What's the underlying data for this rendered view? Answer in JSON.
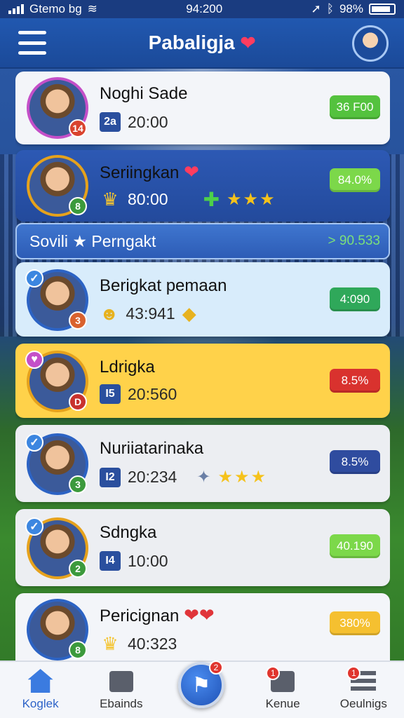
{
  "status_bar": {
    "carrier": "Gtemo bg",
    "time": "94:200",
    "battery": "98%"
  },
  "header": {
    "title": "Pabaligja",
    "menu_icon": "hamburger-icon",
    "heart_icon": "heart-icon",
    "avatar_icon": "profile-avatar"
  },
  "rows_top": [
    {
      "name": "Noghi Sade",
      "level": "14",
      "rank_icon": "rank-chip",
      "rank_text": "2a",
      "score": "20:00",
      "badge": "36 F00",
      "badge_color": "#54c23e"
    },
    {
      "name": "Seriingkan",
      "level": "8",
      "rank_icon": "crown-icon",
      "score": "80:00",
      "badge": "84.0%",
      "badge_color": "#7cd84a",
      "stars": "★★★"
    }
  ],
  "section": {
    "title": "Sovili ★ Perngakt",
    "value": "> 90.533"
  },
  "rows": [
    {
      "name": "Berigkat pemaan",
      "level": "3",
      "score": "43:941",
      "badge": "4:090",
      "badge_color": "#2fa85a"
    },
    {
      "name": "Ldrigka",
      "level": "D",
      "rank_text": "I5",
      "score": "20:560",
      "badge": "8.5%",
      "badge_color": "#d9322e"
    },
    {
      "name": "Nuriiatarinaka",
      "level": "3",
      "rank_text": "I2",
      "score": "20:234",
      "badge": "8.5%",
      "badge_color": "#2f4c9f",
      "stars": "★★★"
    },
    {
      "name": "Sdngka",
      "level": "2",
      "rank_text": "I4",
      "score": "10:00",
      "badge": "40.190",
      "badge_color": "#7cd84a"
    },
    {
      "name": "Pericignan",
      "level": "8",
      "score": "40:323",
      "badge": "380%",
      "badge_color": "#f5c030"
    }
  ],
  "bottom_nav": [
    {
      "label": "Koglek",
      "icon": "home-icon",
      "active": true
    },
    {
      "label": "Ebainds",
      "icon": "shop-icon"
    },
    {
      "label": "Kenue",
      "icon": "calendar-icon",
      "notif": "1"
    },
    {
      "label": "Oeulnigs",
      "icon": "menu-icon",
      "notif": "1"
    }
  ],
  "fab": {
    "icon": "play-flag-icon",
    "notif": "2"
  }
}
